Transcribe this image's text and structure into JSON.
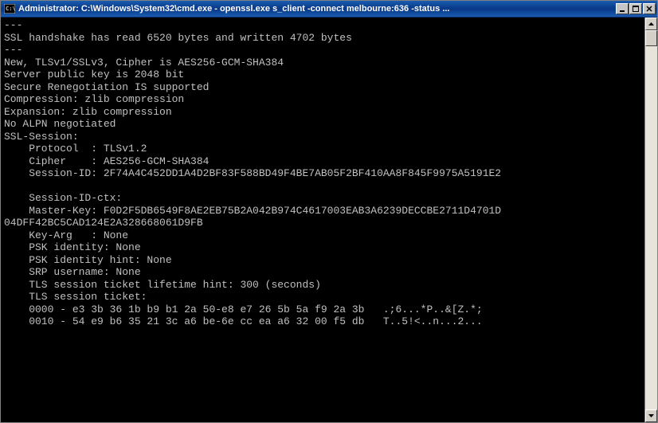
{
  "titlebar": {
    "label": "Administrator: C:\\Windows\\System32\\cmd.exe - openssl.exe  s_client -connect melbourne:636 -status ..."
  },
  "terminal": {
    "lines": [
      "---",
      "SSL handshake has read 6520 bytes and written 4702 bytes",
      "---",
      "New, TLSv1/SSLv3, Cipher is AES256-GCM-SHA384",
      "Server public key is 2048 bit",
      "Secure Renegotiation IS supported",
      "Compression: zlib compression",
      "Expansion: zlib compression",
      "No ALPN negotiated",
      "SSL-Session:",
      "    Protocol  : TLSv1.2",
      "    Cipher    : AES256-GCM-SHA384",
      "    Session-ID: 2F74A4C452DD1A4D2BF83F588BD49F4BE7AB05F2BF410AA8F845F9975A5191E2",
      "",
      "    Session-ID-ctx:",
      "    Master-Key: F0D2F5DB6549F8AE2EB75B2A042B974C4617003EAB3A6239DECCBE2711D4701D",
      "04DFF42BC5CAD124E2A328668061D9FB",
      "    Key-Arg   : None",
      "    PSK identity: None",
      "    PSK identity hint: None",
      "    SRP username: None",
      "    TLS session ticket lifetime hint: 300 (seconds)",
      "    TLS session ticket:",
      "    0000 - e3 3b 36 1b b9 b1 2a 50-e8 e7 26 5b 5a f9 2a 3b   .;6...*P..&[Z.*;",
      "    0010 - 54 e9 b6 35 21 3c a6 be-6e cc ea a6 32 00 f5 db   T..5!<..n...2..."
    ]
  }
}
